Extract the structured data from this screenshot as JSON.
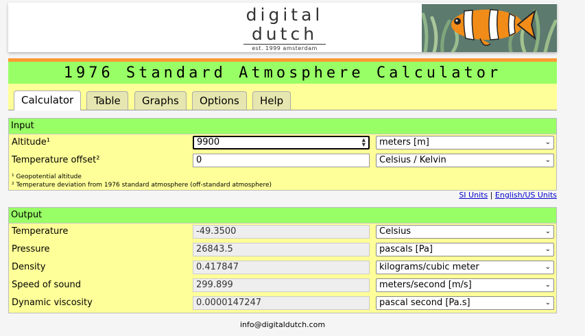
{
  "logo": {
    "line1": "digital",
    "line2": "dutch",
    "tagline": "est. 1999 amsterdam"
  },
  "title": "1976 Standard Atmosphere Calculator",
  "tabs": [
    {
      "label": "Calculator",
      "active": true
    },
    {
      "label": "Table"
    },
    {
      "label": "Graphs"
    },
    {
      "label": "Options"
    },
    {
      "label": "Help"
    }
  ],
  "input": {
    "heading": "Input",
    "rows": [
      {
        "label": "Altitude¹",
        "value": "9900",
        "unit": "meters [m]"
      },
      {
        "label": "Temperature offset²",
        "value": "0",
        "unit": "Celsius / Kelvin"
      }
    ],
    "note1": "¹ Geopotential altitude",
    "note2": "² Temperature deviation from 1976 standard atmosphere (off-standard atmosphere)"
  },
  "unit_links": {
    "si": "SI Units",
    "sep": "|",
    "us": "English/US Units"
  },
  "output": {
    "heading": "Output",
    "rows": [
      {
        "label": "Temperature",
        "value": "-49.3500",
        "unit": "Celsius"
      },
      {
        "label": "Pressure",
        "value": "26843.5",
        "unit": "pascals [Pa]"
      },
      {
        "label": "Density",
        "value": "0.417847",
        "unit": "kilograms/cubic meter"
      },
      {
        "label": "Speed of sound",
        "value": "299.899",
        "unit": "meters/second [m/s]"
      },
      {
        "label": "Dynamic viscosity",
        "value": "0.0000147247",
        "unit": "pascal second [Pa.s]"
      }
    ]
  },
  "footer": "info@digitaldutch.com",
  "colors": {
    "title_bg": "#99ff66",
    "panel_bg": "#ffff99",
    "accent": "#ff9933"
  }
}
